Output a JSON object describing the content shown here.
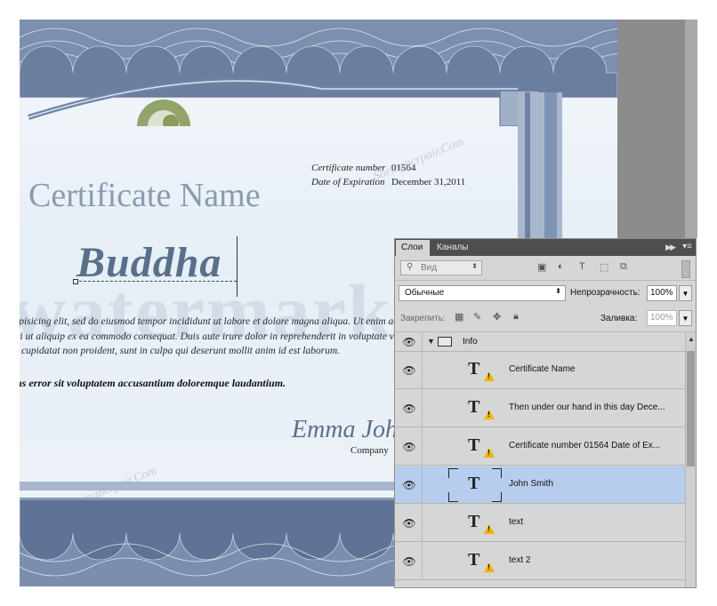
{
  "certificate": {
    "title": "Certificate Name",
    "number_label": "Certificate number",
    "number_value": "01564",
    "expiration_label": "Date of Expiration",
    "expiration_value": "December 31,2011",
    "name_text": "Buddha",
    "body_lines": [
      "ipisicing elit, sed do eiusmod tempor incididunt ut labore et dolore magna aliqua. Ut enim ad mi",
      "ri ut aliquip ex ea commodo consequat. Duis aute irure dolor in reprehenderit in voluptate velit",
      "t cupidatat non proident, sunt in culpa qui deserunt mollit anim id est laborum."
    ],
    "body_bold": "us error sit voluptatem accusantium doloremque laudantium.",
    "signature": "Emma John",
    "company": "Company",
    "watermark_text": "watermark",
    "site_watermark": "Soringpcrpair.Com"
  },
  "panel": {
    "tabs": [
      "Слои",
      "Каналы"
    ],
    "filter_kind": "Вид",
    "blend_mode": "Обычные",
    "opacity_label": "Непрозрачность:",
    "opacity_value": "100%",
    "lock_label": "Закрепить:",
    "fill_label": "Заливка:",
    "fill_value": "100%",
    "group_name": "Info",
    "layers": [
      {
        "name": "Certificate Name",
        "warning": true,
        "selected": false
      },
      {
        "name": "Then under our hand in this day Dece...",
        "warning": true,
        "selected": false
      },
      {
        "name": "Certificate number    01564 Date of Ex...",
        "warning": true,
        "selected": false
      },
      {
        "name": "John Smith",
        "warning": false,
        "selected": true
      },
      {
        "name": "text",
        "warning": true,
        "selected": false
      },
      {
        "name": "text 2",
        "warning": true,
        "selected": false
      }
    ]
  },
  "colors": {
    "selected_layer": "#b6cdee",
    "warning": "#f0b400",
    "certificate_accent": "#5a6f8a"
  }
}
